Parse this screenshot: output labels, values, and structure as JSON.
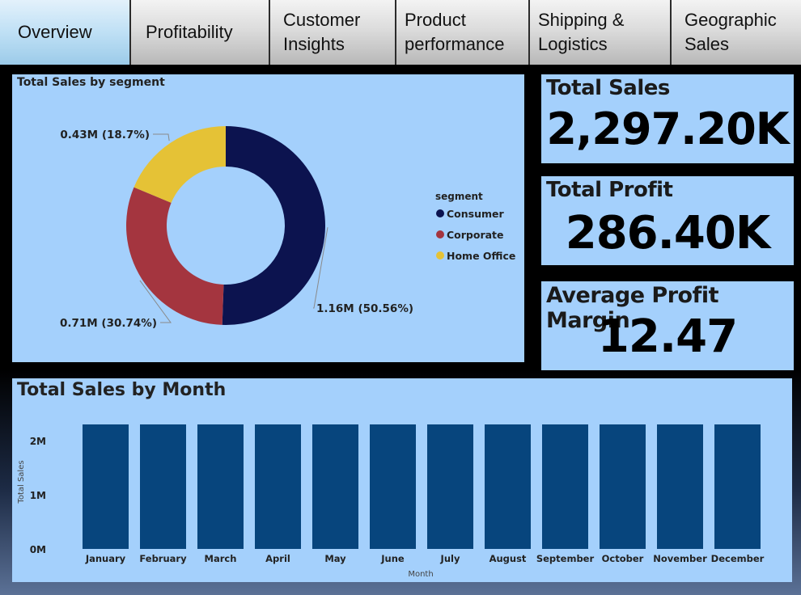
{
  "tabs": [
    {
      "label": "Overview",
      "active": true
    },
    {
      "label": "Profitability",
      "active": false
    },
    {
      "label": "Customer\nInsights",
      "active": false
    },
    {
      "label": "Product\nperformance",
      "active": false
    },
    {
      "label": "Shipping &\nLogistics",
      "active": false
    },
    {
      "label": "Geographic\nSales",
      "active": false
    }
  ],
  "kpis": {
    "total_sales": {
      "title": "Total Sales",
      "value": "2,297.20K"
    },
    "total_profit": {
      "title": "Total Profit",
      "value": "286.40K"
    },
    "avg_margin": {
      "title": "Average Profit Margin",
      "value": "12.47"
    }
  },
  "donut": {
    "title": "Total Sales by segment",
    "legend_title": "segment"
  },
  "bars": {
    "title": "Total Sales by Month"
  },
  "chart_data": [
    {
      "type": "pie",
      "title": "Total Sales by segment",
      "legend_title": "segment",
      "legend_position": "right",
      "donut": true,
      "slices": [
        {
          "name": "Consumer",
          "value": 1.16,
          "percent": 50.56,
          "label": "1.16M (50.56%)",
          "color": "#0c134f"
        },
        {
          "name": "Corporate",
          "value": 0.71,
          "percent": 30.74,
          "label": "0.71M (30.74%)",
          "color": "#a4353f"
        },
        {
          "name": "Home Office",
          "value": 0.43,
          "percent": 18.7,
          "label": "0.43M (18.7%)",
          "color": "#e5c236"
        }
      ]
    },
    {
      "type": "bar",
      "title": "Total Sales by Month",
      "xlabel": "Month",
      "ylabel": "Total Sales",
      "ylim": [
        0,
        2.3
      ],
      "ytick_labels": [
        "0M",
        "1M",
        "2M"
      ],
      "ytick_values": [
        0,
        1,
        2
      ],
      "categories": [
        "January",
        "February",
        "March",
        "April",
        "May",
        "June",
        "July",
        "August",
        "September",
        "October",
        "November",
        "December"
      ],
      "values": [
        2.3,
        2.3,
        2.3,
        2.3,
        2.3,
        2.3,
        2.3,
        2.3,
        2.3,
        2.3,
        2.3,
        2.3
      ],
      "color": "#07457d",
      "grid": false
    }
  ]
}
